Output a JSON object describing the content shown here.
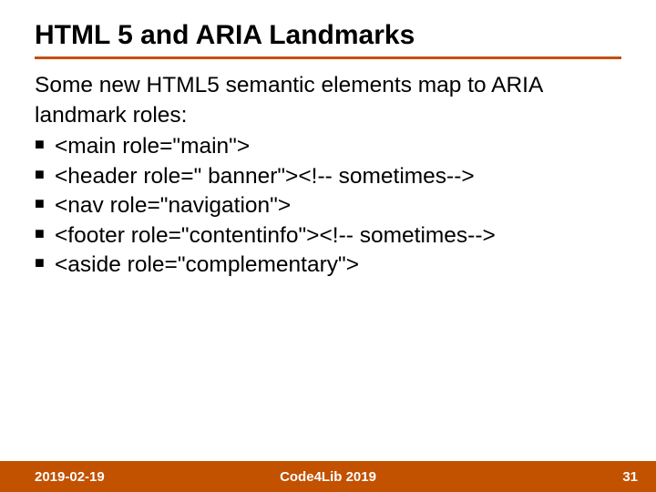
{
  "title": "HTML 5 and ARIA Landmarks",
  "lead": "Some new HTML5 semantic elements map to ARIA landmark roles:",
  "items": [
    "<main role=\"main\">",
    "<header role=\" banner\"><!-- sometimes-->",
    "<nav role=\"navigation\">",
    "<footer role=\"contentinfo\"><!-- sometimes-->",
    "<aside role=\"complementary\">"
  ],
  "footer": {
    "date": "2019-02-19",
    "center": "Code4Lib 2019",
    "page": "31"
  }
}
